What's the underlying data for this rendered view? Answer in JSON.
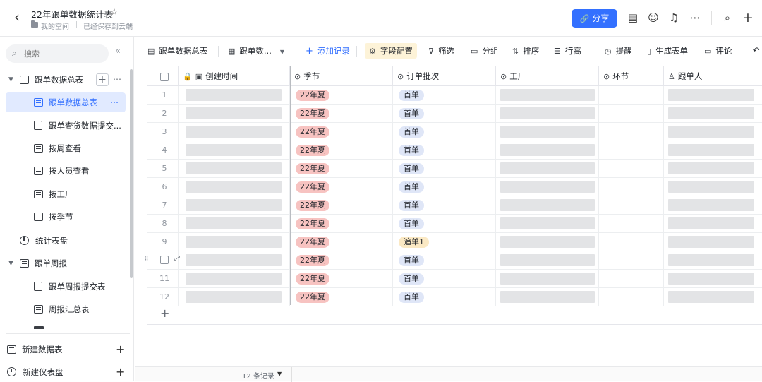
{
  "header": {
    "title": "22年跟单数据统计表",
    "space": "我的空间",
    "saved_status": "已经保存到云端",
    "share_label": "分享"
  },
  "sidebar": {
    "search_placeholder": "搜索",
    "items": [
      {
        "label": "跟单数据总表"
      },
      {
        "label": "跟单数据总表"
      },
      {
        "label": "跟单查货数据提交..."
      },
      {
        "label": "按周查看"
      },
      {
        "label": "按人员查看"
      },
      {
        "label": "按工厂"
      },
      {
        "label": "按季节"
      },
      {
        "label": "统计表盘"
      },
      {
        "label": "跟单周报"
      },
      {
        "label": "跟单周报提交表"
      },
      {
        "label": "周报汇总表"
      }
    ],
    "new_table_label": "新建数据表",
    "new_dashboard_label": "新建仪表盘"
  },
  "toolbar": {
    "table_name": "跟单数据总表",
    "view_name": "跟单数...",
    "add_record": "添加记录",
    "field_config": "字段配置",
    "filter": "筛选",
    "group": "分组",
    "sort": "排序",
    "row_height": "行高",
    "reminder": "提醒",
    "generate_form": "生成表单",
    "comment": "评论"
  },
  "grid": {
    "columns": [
      "创建时间",
      "季节",
      "订单批次",
      "工厂",
      "环节",
      "跟单人"
    ],
    "rows": [
      {
        "num": "1",
        "season": "22年夏",
        "order": "首单"
      },
      {
        "num": "2",
        "season": "22年夏",
        "order": "首单"
      },
      {
        "num": "3",
        "season": "22年夏",
        "order": "首单"
      },
      {
        "num": "4",
        "season": "22年夏",
        "order": "首单"
      },
      {
        "num": "5",
        "season": "22年夏",
        "order": "首单"
      },
      {
        "num": "6",
        "season": "22年夏",
        "order": "首单"
      },
      {
        "num": "7",
        "season": "22年夏",
        "order": "首单"
      },
      {
        "num": "8",
        "season": "22年夏",
        "order": "首单"
      },
      {
        "num": "9",
        "season": "22年夏",
        "order": "追单1"
      },
      {
        "num": "",
        "season": "22年夏",
        "order": "首单"
      },
      {
        "num": "11",
        "season": "22年夏",
        "order": "首单"
      },
      {
        "num": "12",
        "season": "22年夏",
        "order": "首单"
      }
    ]
  },
  "status": {
    "record_count": "12 条记录"
  }
}
